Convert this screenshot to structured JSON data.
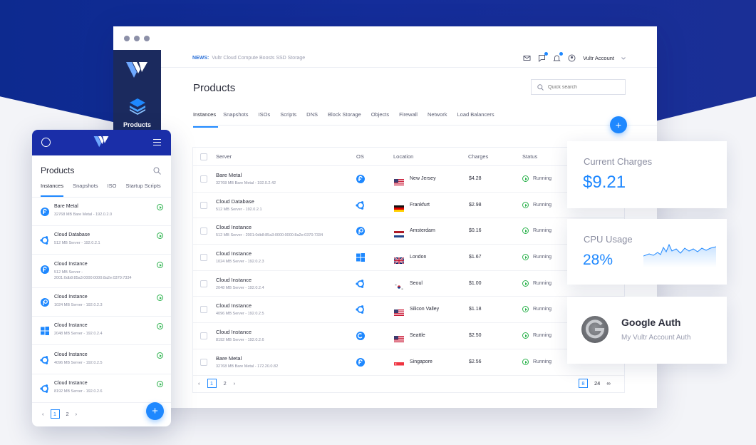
{
  "colors": {
    "accent": "#1e88ff",
    "brand": "#1a2ea8",
    "sidebar": "#1b2a5e",
    "running": "#2bb24c"
  },
  "topbar": {
    "news_label": "NEWS:",
    "news_text": "Vultr Cloud Compute Boosts SSD Storage",
    "account": "Vultr Account"
  },
  "sidebar": {
    "products_label": "Products"
  },
  "page": {
    "title": "Products",
    "search_placeholder": "Quick search"
  },
  "tabs": [
    "Instances",
    "Snapshots",
    "ISOs",
    "Scripts",
    "DNS",
    "Block Storage",
    "Objects",
    "Firewall",
    "Network",
    "Load Balancers"
  ],
  "table": {
    "headers": {
      "server": "Server",
      "os": "OS",
      "location": "Location",
      "charges": "Charges",
      "status": "Status"
    },
    "rows": [
      {
        "name": "Bare Metal",
        "sub": "32768 MB Bare Metal - 192.0.2.42",
        "os": "fedora",
        "flag": "us",
        "location": "New Jersey",
        "charges": "$4.28",
        "status": "Running"
      },
      {
        "name": "Cloud Database",
        "sub": "512 MB Server - 192.0.2.1",
        "os": "ubuntu",
        "flag": "de",
        "location": "Frankfurt",
        "charges": "$2.98",
        "status": "Running"
      },
      {
        "name": "Cloud Instance",
        "sub": "512 MB Server - 2001:0db8:85a3:0000:0000:8a2e:0370:7334",
        "os": "openbsd",
        "flag": "nl",
        "location": "Amsterdam",
        "charges": "$0.16",
        "status": "Running"
      },
      {
        "name": "Cloud Instance",
        "sub": "1024 MB Server - 192.0.2.3",
        "os": "windows",
        "flag": "gb",
        "location": "London",
        "charges": "$1.67",
        "status": "Running"
      },
      {
        "name": "Cloud Instance",
        "sub": "2048 MB Server - 192.0.2.4",
        "os": "ubuntu",
        "flag": "kr",
        "location": "Seoul",
        "charges": "$1.00",
        "status": "Running"
      },
      {
        "name": "Cloud Instance",
        "sub": "4096 MB Server - 192.0.2.5",
        "os": "ubuntu",
        "flag": "us",
        "location": "Silicon Valley",
        "charges": "$1.18",
        "status": "Running"
      },
      {
        "name": "Cloud Instance",
        "sub": "8192 MB Server - 192.0.2.6",
        "os": "debian",
        "flag": "us",
        "location": "Seattle",
        "charges": "$2.50",
        "status": "Running"
      },
      {
        "name": "Bare Metal",
        "sub": "32768 MB Bare Metal - 172.20.0.82",
        "os": "fedora",
        "flag": "sg",
        "location": "Singapore",
        "charges": "$2.56",
        "status": "Running"
      }
    ]
  },
  "pager": {
    "page1": "1",
    "page2": "2",
    "per_page": [
      "8",
      "24",
      "∞"
    ]
  },
  "cards": {
    "charges_title": "Current Charges",
    "charges_value": "$9.21",
    "cpu_title": "CPU Usage",
    "cpu_value": "28%",
    "ga_title": "Google Auth",
    "ga_sub": "My Vultr Account Auth"
  },
  "mobile": {
    "title": "Products",
    "tabs": [
      "Instances",
      "Snapshots",
      "ISO",
      "Startup Scripts"
    ],
    "rows": [
      {
        "name": "Bare Metal",
        "sub": "32768 MB Bare Metal - 192.0.2.0",
        "os": "fedora"
      },
      {
        "name": "Cloud Database",
        "sub": "512 MB Server - 192.0.2.1",
        "os": "ubuntu"
      },
      {
        "name": "Cloud Instance",
        "sub": "512 MB Server - 2001:0db8:85a3:0000:0000:8a2e:0370:7334",
        "os": "fedora"
      },
      {
        "name": "Cloud Instance",
        "sub": "1024 MB Server - 192.0.2.3",
        "os": "openbsd"
      },
      {
        "name": "Cloud Instance",
        "sub": "2048 MB Server - 192.0.2.4",
        "os": "windows"
      },
      {
        "name": "Cloud Instance",
        "sub": "4096 MB Server - 192.0.2.5",
        "os": "ubuntu"
      },
      {
        "name": "Cloud Instance",
        "sub": "8192 MB Server - 192.0.2.6",
        "os": "ubuntu"
      }
    ],
    "page1": "1",
    "page2": "2"
  }
}
